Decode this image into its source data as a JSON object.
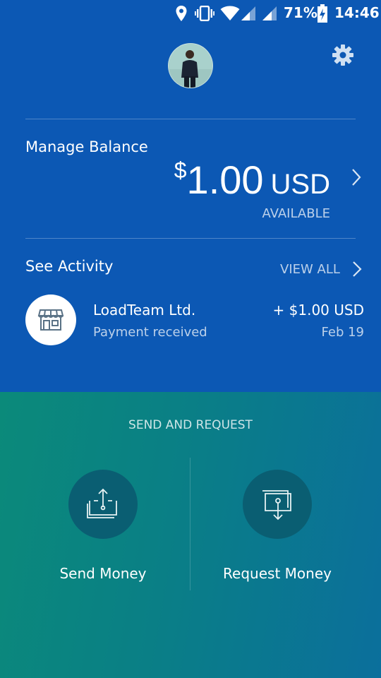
{
  "status_bar": {
    "battery": "71%",
    "time": "14:46",
    "icons": [
      "location-icon",
      "vibrate-icon",
      "wifi-icon",
      "signal-icon",
      "signal-icon",
      "battery-charging-icon"
    ]
  },
  "header": {
    "avatar_icon": "profile-photo",
    "settings_icon": "gear-icon"
  },
  "balance": {
    "title": "Manage Balance",
    "currency_symbol": "$",
    "amount": "1.00",
    "currency_code": "USD",
    "status": "AVAILABLE"
  },
  "activity": {
    "title": "See Activity",
    "view_all": "VIEW ALL",
    "items": [
      {
        "icon": "store-icon",
        "name": "LoadTeam Ltd.",
        "description": "Payment received",
        "amount": "+ $1.00 USD",
        "date": "Feb 19"
      }
    ]
  },
  "send_request": {
    "title": "SEND AND REQUEST",
    "send_label": "Send Money",
    "request_label": "Request Money"
  },
  "colors": {
    "top_bg": "#0c58b4",
    "bottom_gradient_start": "#0b8a7a",
    "bottom_gradient_end": "#0b6f9c",
    "action_circle": "#0a5e72"
  }
}
